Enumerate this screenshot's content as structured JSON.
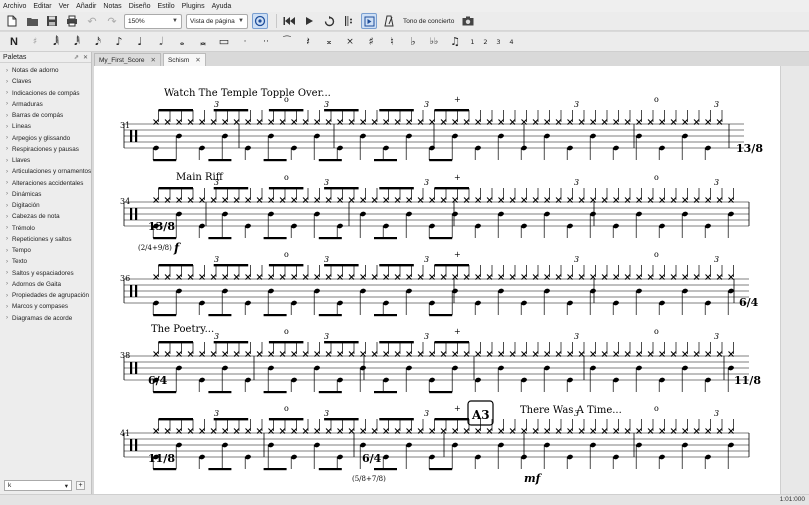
{
  "menu": [
    "Archivo",
    "Editar",
    "Ver",
    "Añadir",
    "Notas",
    "Diseño",
    "Estilo",
    "Plugins",
    "Ayuda"
  ],
  "toolbar": {
    "zoom": "150%",
    "view_mode": "Vista de página",
    "concert_pitch": "Tono de concierto"
  },
  "note_input": {
    "voices": [
      "1",
      "2",
      "3",
      "4"
    ]
  },
  "palettes": {
    "title": "Paletas",
    "items": [
      "Notas de adorno",
      "Claves",
      "Indicaciones de compás",
      "Armaduras",
      "Barras de compás",
      "Líneas",
      "Arpegios y glissando",
      "Respiraciones y pausas",
      "Llaves",
      "Articulaciones y ornamentos",
      "Alteraciones accidentales",
      "Dinámicas",
      "Digitación",
      "Cabezas de nota",
      "Trémolo",
      "Repeticiones y saltos",
      "Tempo",
      "Texto",
      "Saltos y espaciadores",
      "Adornos de Gaita",
      "Propiedades de agrupación",
      "Marcos y compases",
      "Diagramas de acorde"
    ],
    "workspace": "k"
  },
  "tabs": [
    {
      "label": "My_First_Score"
    },
    {
      "label": "Schism"
    }
  ],
  "score": {
    "systems": [
      {
        "measure": "31",
        "text": "Watch The Temple Topple Over...",
        "timesig": "13/8"
      },
      {
        "measure": "34",
        "text": "Main Riff",
        "timesig": "13/8",
        "note": "(2/4+9/8)",
        "dyn": "f"
      },
      {
        "measure": "36",
        "text": "",
        "timesig": "6/4"
      },
      {
        "measure": "38",
        "text": "The Poetry...",
        "timesig": "6/4",
        "timesig_end": "11/8"
      },
      {
        "measure": "41",
        "text": "",
        "timesig": "11/8",
        "timesig_mid": "6/4",
        "note": "(5/8+7/8)",
        "rehearsal": "A3",
        "text2": "There Was A Time...",
        "dyn": "mf"
      }
    ],
    "tuplet": "3",
    "open_hh": "o",
    "closed_hh": "+"
  },
  "status": {
    "time": "1:01:000"
  }
}
